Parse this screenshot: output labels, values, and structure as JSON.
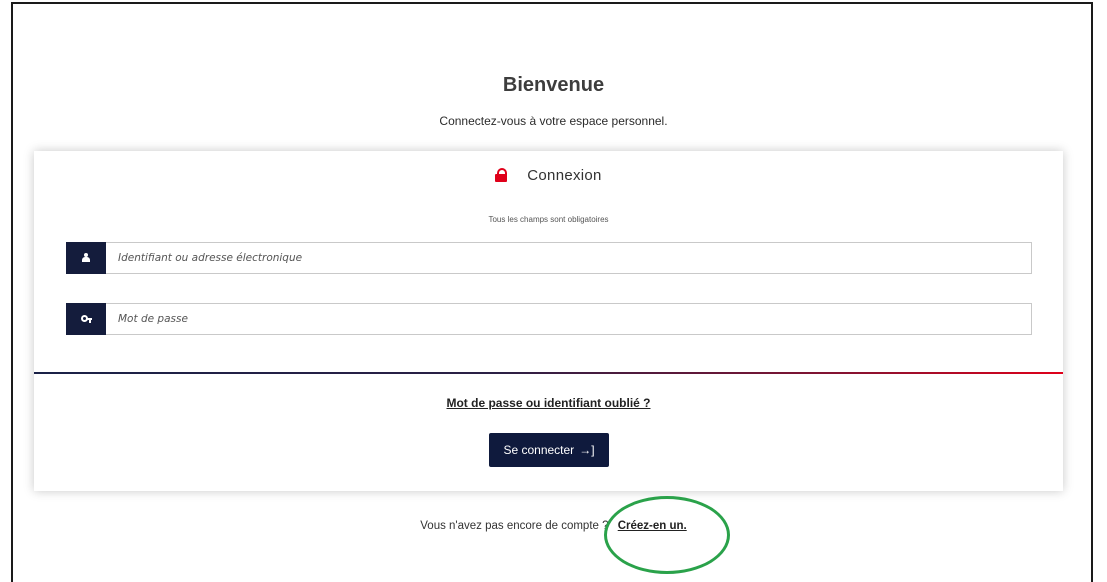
{
  "header": {
    "title": "Bienvenue",
    "subtitle": "Connectez-vous à votre espace personnel."
  },
  "card": {
    "title": "Connexion",
    "title_icon": "lock-icon",
    "required_note": "Tous les champs sont obligatoires",
    "username": {
      "placeholder": "Identifiant ou adresse électronique",
      "value": "",
      "icon": "user-icon"
    },
    "password": {
      "placeholder": "Mot de passe",
      "value": "",
      "icon": "key-icon"
    },
    "forgot_link": "Mot de passe ou identifiant oublié ?",
    "login_button": {
      "label": "Se connecter",
      "icon": "sign-in-icon"
    }
  },
  "footer": {
    "prompt": "Vous n'avez pas encore de compte ?",
    "create_link": "Créez-en un."
  },
  "colors": {
    "accent_red": "#e0001a",
    "navy": "#0f1a3d",
    "highlight_green": "#2aa24a"
  }
}
